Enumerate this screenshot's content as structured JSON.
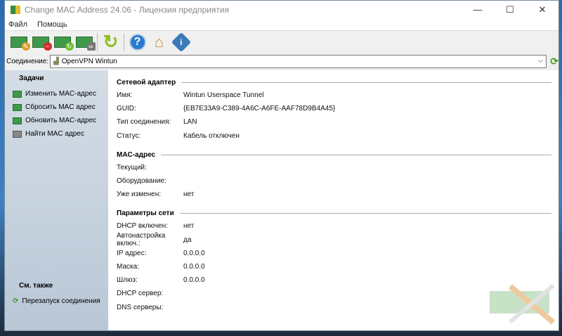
{
  "window": {
    "title": "Change MAC Address 24.06 - Лицензия предприятия",
    "minimize": "—",
    "maximize": "☐",
    "close": "✕"
  },
  "menu": [
    "Файл",
    "Помощь"
  ],
  "toolbar": [
    {
      "name": "change-mac",
      "icon": "card-pencil-icon"
    },
    {
      "name": "reset-mac",
      "icon": "card-delete-icon"
    },
    {
      "name": "refresh-mac",
      "icon": "card-refresh-icon"
    },
    {
      "name": "find-mac",
      "icon": "card-binoculars-icon"
    },
    {
      "name": "restart",
      "icon": "refresh-icon"
    },
    {
      "name": "help",
      "icon": "help-icon",
      "glyph": "?"
    },
    {
      "name": "home",
      "icon": "home-icon"
    },
    {
      "name": "about",
      "icon": "info-icon",
      "glyph": "i"
    }
  ],
  "connection": {
    "label": "Соединение:",
    "value": "OpenVPN Wintun"
  },
  "sidebar": {
    "tasks_title": "Задачи",
    "tasks": [
      "Изменить MAC-адрес",
      "Сбросить MAC адрес",
      "Обновить MAC-адрес",
      "Найти MAC адрес"
    ],
    "see_also_title": "См. также",
    "see_also": [
      "Перезапуск соединения"
    ]
  },
  "sections": [
    {
      "title": "Сетевой адаптер",
      "rows": [
        {
          "k": "Имя:",
          "v": "Wintun Userspace Tunnel"
        },
        {
          "k": "GUID:",
          "v": "{EB7E33A9-C389-4A6C-A6FE-AAF78D9B4A45}"
        },
        {
          "k": "Тип соединения:",
          "v": "LAN"
        },
        {
          "k": "Статус:",
          "v": "Кабель отключен"
        }
      ]
    },
    {
      "title": "MAC-адрес",
      "rows": [
        {
          "k": "Текущий:",
          "v": ""
        },
        {
          "k": "Оборудование:",
          "v": ""
        },
        {
          "k": "Уже изменен:",
          "v": "нет"
        }
      ]
    },
    {
      "title": "Параметры сети",
      "rows": [
        {
          "k": "DHCP включен:",
          "v": "нет"
        },
        {
          "k": "Автонастройка включ.:",
          "v": "да"
        },
        {
          "k": "IP адрес:",
          "v": "0.0.0.0"
        },
        {
          "k": "Маска:",
          "v": "0.0.0.0"
        },
        {
          "k": "Шлюз:",
          "v": "0.0.0.0"
        },
        {
          "k": "DHCP сервер:",
          "v": ""
        },
        {
          "k": "DNS серверы:",
          "v": ""
        }
      ]
    }
  ]
}
